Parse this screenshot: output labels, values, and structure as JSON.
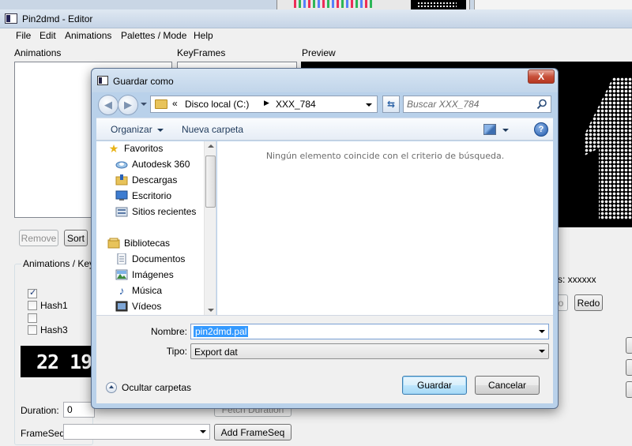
{
  "editor": {
    "title": "Pin2dmd - Editor",
    "menu": [
      "File",
      "Edit",
      "Animations",
      "Palettes / Mode",
      "Help"
    ],
    "animations_label": "Animations",
    "keyframes_label": "KeyFrames",
    "preview_label": "Preview",
    "remove_label": "Remove",
    "sort_label": "Sort",
    "group_label": "Animations / KeyFr",
    "hash1_label": "Hash1",
    "hash3_label": "Hash3",
    "dmd_text": "22 19",
    "duration_label": "Duration:",
    "duration_value": "0",
    "fetch_duration_label": "Fetch Duration",
    "frameseq_label": "FrameSeq",
    "add_frameseq_label": "Add FrameSeq",
    "status_text": "s: xxxxxx",
    "undo_label": "o",
    "redo_label": "Redo"
  },
  "dialog": {
    "title": "Guardar como",
    "close_label": "X",
    "address": {
      "chevron": "«",
      "segments": [
        "Disco local (C:)",
        "XXX_784"
      ]
    },
    "search_placeholder": "Buscar XXX_784",
    "toolbar": {
      "organize_label": "Organizar",
      "new_folder_label": "Nueva carpeta"
    },
    "nav_tree": [
      {
        "label": "Favoritos",
        "icon": "star-icon"
      },
      {
        "label": "Autodesk 360",
        "icon": "cloud-icon"
      },
      {
        "label": "Descargas",
        "icon": "downloads-folder-icon"
      },
      {
        "label": "Escritorio",
        "icon": "desktop-icon"
      },
      {
        "label": "Sitios recientes",
        "icon": "recent-places-icon"
      },
      {
        "label": "Bibliotecas",
        "icon": "libraries-icon"
      },
      {
        "label": "Documentos",
        "icon": "documents-icon"
      },
      {
        "label": "Imágenes",
        "icon": "pictures-icon"
      },
      {
        "label": "Música",
        "icon": "music-icon"
      },
      {
        "label": "Vídeos",
        "icon": "videos-icon"
      }
    ],
    "empty_message": "Ningún elemento coincide con el criterio de búsqueda.",
    "name_label": "Nombre:",
    "name_value": "pin2dmd.pal",
    "type_label": "Tipo:",
    "type_value": "Export dat",
    "hide_folders_label": "Ocultar carpetas",
    "save_label": "Guardar",
    "cancel_label": "Cancelar"
  }
}
